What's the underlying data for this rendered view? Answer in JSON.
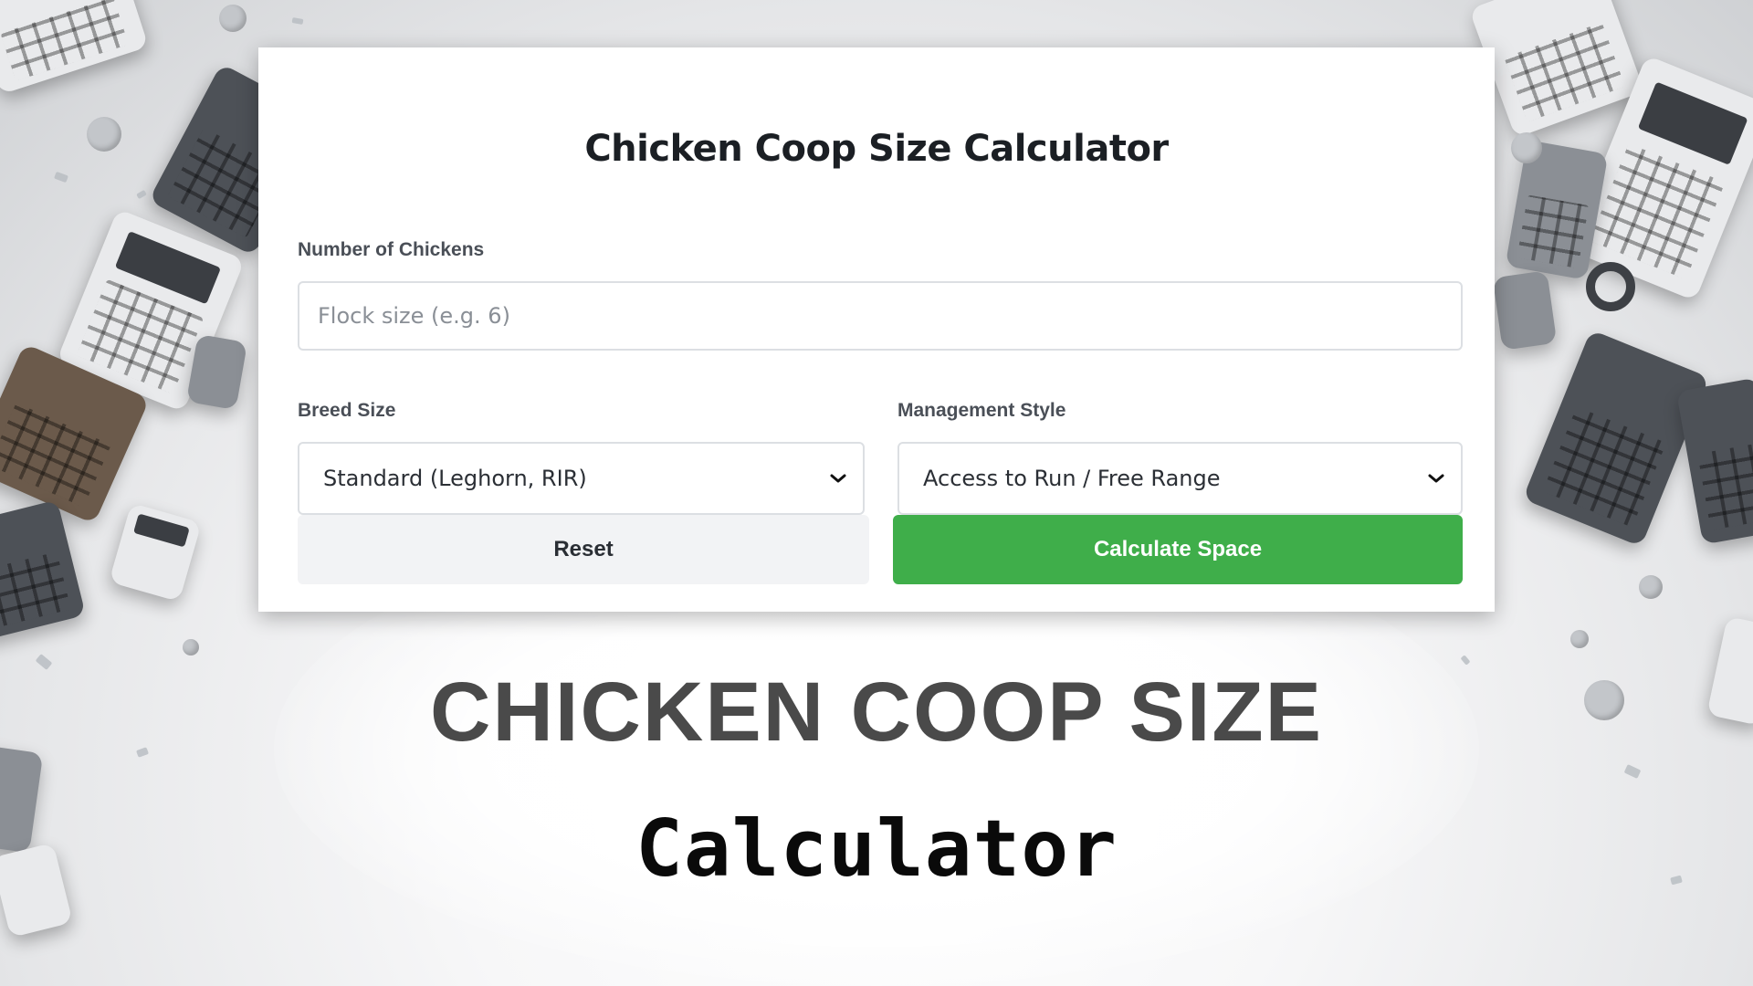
{
  "calculator": {
    "title": "Chicken Coop Size Calculator",
    "chickens": {
      "label": "Number of Chickens",
      "placeholder": "Flock size (e.g. 6)",
      "value": ""
    },
    "breed": {
      "label": "Breed Size",
      "selected": "Standard (Leghorn, RIR)"
    },
    "management": {
      "label": "Management Style",
      "selected": "Access to Run / Free Range"
    },
    "reset_label": "Reset",
    "calculate_label": "Calculate Space"
  },
  "banner": {
    "headline": "CHICKEN COOP SIZE",
    "subline": "Calculator"
  },
  "icons": {
    "select_arrow": "chevron-down-icon"
  },
  "colors": {
    "calculate_button": "#3fae4a",
    "reset_button": "#f2f3f5",
    "title_text": "#1b1f24",
    "headline_text": "#4a4a4a"
  }
}
